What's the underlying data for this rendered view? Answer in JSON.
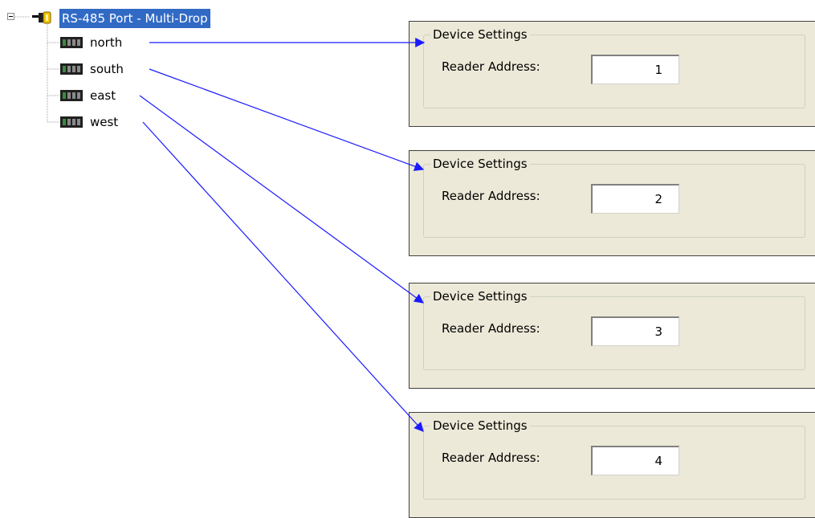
{
  "tree": {
    "root_label": "RS-485 Port - Multi-Drop",
    "root_icon": "serial-port-icon",
    "expander_icon": "collapse-minus-icon",
    "children": [
      {
        "label": "north",
        "icon": "reader-device-icon"
      },
      {
        "label": "south",
        "icon": "reader-device-icon"
      },
      {
        "label": "east",
        "icon": "reader-device-icon"
      },
      {
        "label": "west",
        "icon": "reader-device-icon"
      }
    ]
  },
  "panels": [
    {
      "group_title": "Device Settings",
      "field_label": "Reader Address:",
      "value": "1"
    },
    {
      "group_title": "Device Settings",
      "field_label": "Reader Address:",
      "value": "2"
    },
    {
      "group_title": "Device Settings",
      "field_label": "Reader Address:",
      "value": "3"
    },
    {
      "group_title": "Device Settings",
      "field_label": "Reader Address:",
      "value": "4"
    }
  ],
  "colors": {
    "selection": "#316ac5",
    "panel_background": "#ece9d8",
    "arrow": "#1a1aff"
  }
}
